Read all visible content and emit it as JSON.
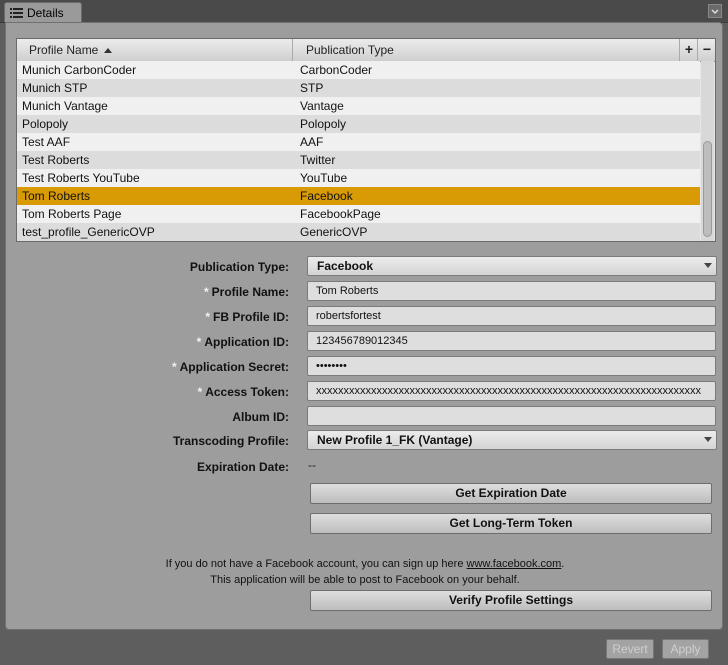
{
  "tab": {
    "label": "Details"
  },
  "table": {
    "columns": {
      "profile_name": "Profile Name",
      "publication_type": "Publication Type"
    },
    "add_label": "+",
    "remove_label": "−",
    "rows": [
      {
        "name": "Munich CarbonCoder",
        "type": "CarbonCoder"
      },
      {
        "name": "Munich STP",
        "type": "STP"
      },
      {
        "name": "Munich Vantage",
        "type": "Vantage"
      },
      {
        "name": "Polopoly",
        "type": "Polopoly"
      },
      {
        "name": "Test AAF",
        "type": "AAF"
      },
      {
        "name": "Test Roberts",
        "type": "Twitter"
      },
      {
        "name": "Test Roberts YouTube",
        "type": "YouTube"
      },
      {
        "name": "Tom Roberts",
        "type": "Facebook"
      },
      {
        "name": "Tom Roberts Page",
        "type": "FacebookPage"
      },
      {
        "name": "test_profile_GenericOVP",
        "type": "GenericOVP"
      }
    ],
    "selected_index": 7
  },
  "form": {
    "publication_type": {
      "label": "Publication Type:",
      "value": "Facebook"
    },
    "profile_name": {
      "label": "Profile Name:",
      "value": "Tom Roberts"
    },
    "fb_profile_id": {
      "label": "FB Profile ID:",
      "value": "robertsfortest"
    },
    "application_id": {
      "label": "Application ID:",
      "value": "123456789012345"
    },
    "application_secret": {
      "label": "Application Secret:",
      "value": "secretxx"
    },
    "access_token": {
      "label": "Access Token:",
      "value": "xxxxxxxxxxxxxxxxxxxxxxxxxxxxxxxxxxxxxxxxxxxxxxxxxxxxxxxxxxxxxxxxxxxxxx"
    },
    "album_id": {
      "label": "Album ID:",
      "value": ""
    },
    "transcoding_profile": {
      "label": "Transcoding Profile:",
      "value": "New Profile 1_FK (Vantage)"
    },
    "expiration_date": {
      "label": "Expiration Date:",
      "value": "--"
    },
    "required_marker": "*"
  },
  "buttons": {
    "get_expiration": "Get Expiration Date",
    "get_long_term": "Get Long-Term Token",
    "verify": "Verify Profile Settings",
    "revert": "Revert",
    "apply": "Apply"
  },
  "info": {
    "line1_prefix": "If you do not have a Facebook account, you can sign up here ",
    "link": "www.facebook.com",
    "line1_suffix": ".",
    "line2": "This application will be able to post to Facebook on your behalf."
  },
  "colors": {
    "selection": "#d89a05",
    "panel": "#9d9d9d",
    "background": "#5e5e5e"
  }
}
